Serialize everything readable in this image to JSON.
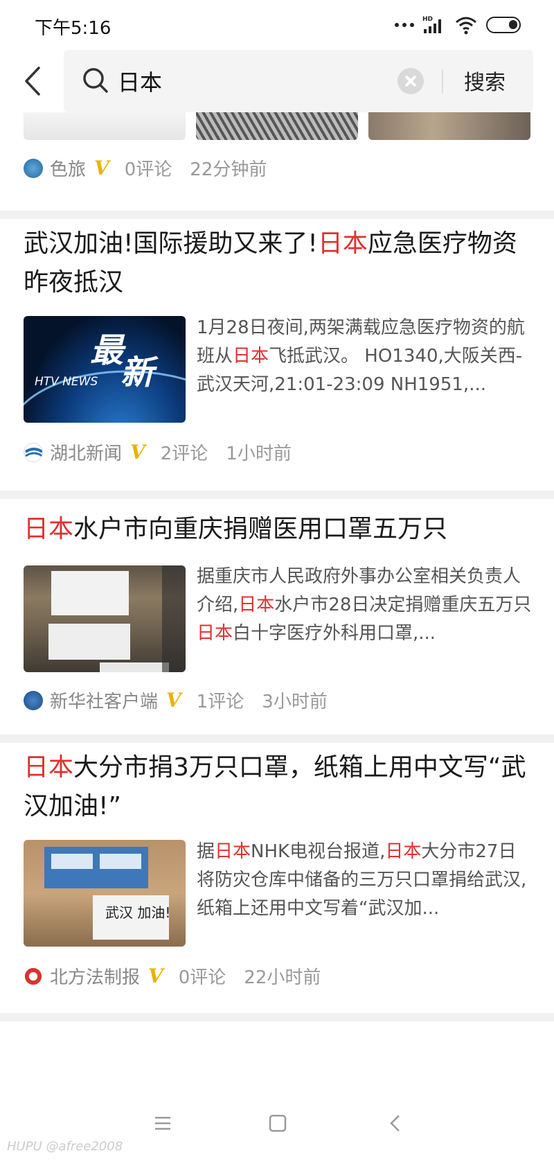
{
  "status_bar": {
    "time": "下午5:16",
    "hd_label": "HD"
  },
  "search": {
    "query": "日本",
    "button_label": "搜索"
  },
  "partial_item": {
    "source": "色旅",
    "comments": "0评论",
    "time": "22分钟前"
  },
  "articles": [
    {
      "title_parts": [
        "武汉加油!国际援助又来了!",
        "日本",
        "应急医疗物资昨夜抵汉"
      ],
      "summary_parts": [
        "1月28日夜间,两架满载应急医疗物资的航班从",
        "日本",
        "飞抵武汉。 HO1340,大阪关西-武汉天河,21:01-23:09 NH1951,..."
      ],
      "thumb_text_top": "最",
      "thumb_text_bottom": "新",
      "thumb_brand": "HTV NEWS",
      "source": "湖北新闻",
      "comments": "2评论",
      "time": "1小时前"
    },
    {
      "title_parts": [
        "日本",
        "水户市向重庆捐赠医用口罩五万只"
      ],
      "summary_parts": [
        "据重庆市人民政府外事办公室相关负责人介绍,",
        "日本",
        "水户市28日决定捐赠重庆五万只",
        "日本",
        "白十字医疗外科用口罩,..."
      ],
      "source": "新华社客户端",
      "comments": "1评论",
      "time": "3小时前"
    },
    {
      "title_parts": [
        "日本",
        "大分市捐3万只口罩，纸箱上用中文写“武汉加油!”"
      ],
      "summary_parts": [
        "据",
        "日本",
        "NHK电视台报道,",
        "日本",
        "大分市27日将防灾仓库中储备的三万只口罩捐给武汉,纸箱上还用中文写着“武汉加..."
      ],
      "thumb_box_label": "武汉 加油!",
      "source": "北方法制报",
      "comments": "0评论",
      "time": "22小时前"
    }
  ],
  "verified_badge": "V",
  "watermark": "HUPU @afree2008",
  "colors": {
    "highlight": "#e0302f",
    "verified": "#e8b400",
    "meta": "#999999"
  }
}
